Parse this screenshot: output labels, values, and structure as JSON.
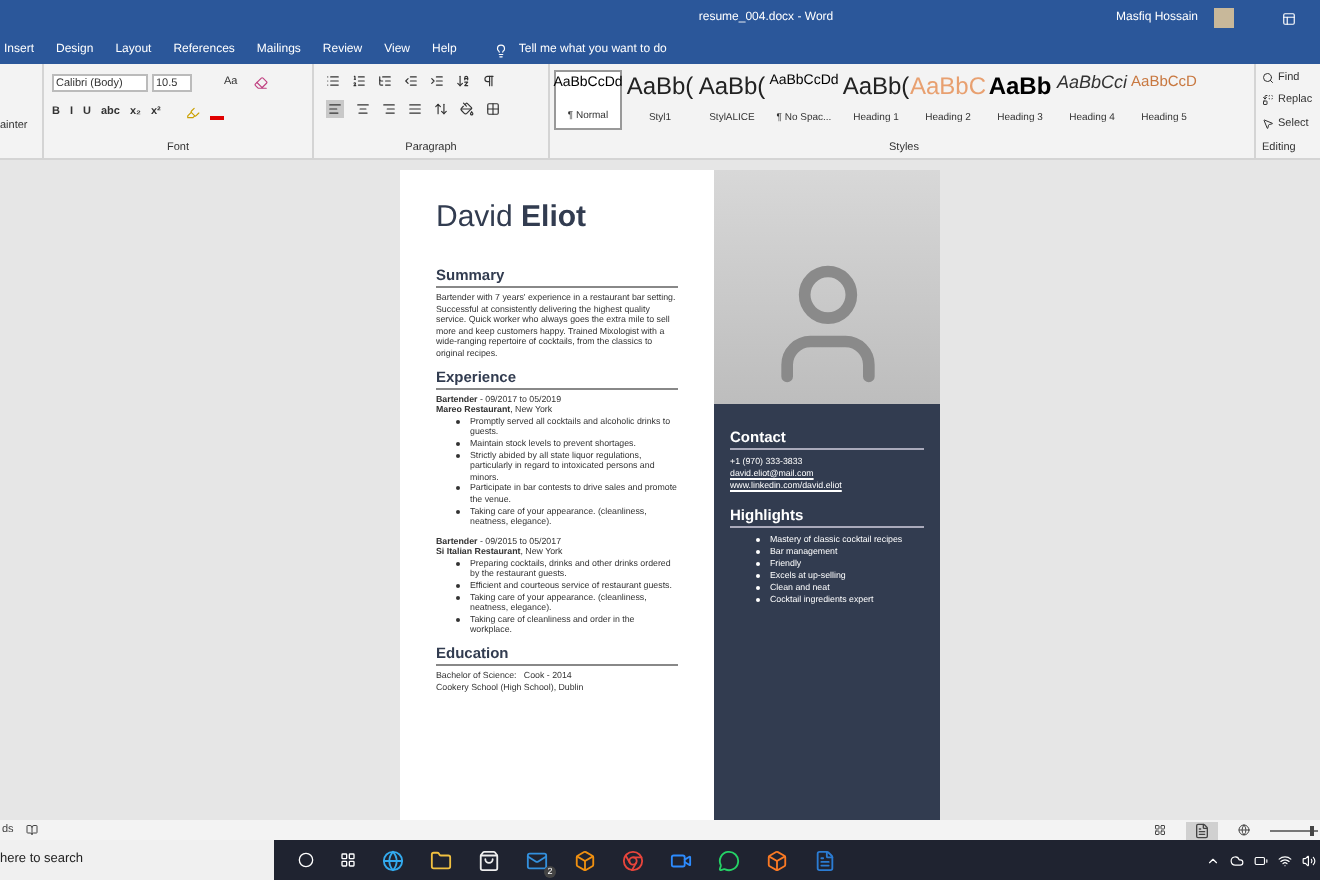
{
  "window": {
    "title": "resume_004.docx  -  Word",
    "user": "Masfiq Hossain"
  },
  "menu_tabs": [
    {
      "label": "Insert",
      "selected": false
    },
    {
      "label": "Design",
      "selected": false
    },
    {
      "label": "Layout",
      "selected": false
    },
    {
      "label": "References",
      "selected": false
    },
    {
      "label": "Mailings",
      "selected": false
    },
    {
      "label": "Review",
      "selected": false
    },
    {
      "label": "View",
      "selected": false
    },
    {
      "label": "Help",
      "selected": false
    }
  ],
  "tell_me": "Tell me what you want to do",
  "ribbon": {
    "clipboard_label": "ainter",
    "font_name": "Calibri (Body)",
    "font_size": "10.5",
    "case_button": "Aa",
    "format_buttons": [
      "B",
      "I",
      "U",
      "abc",
      "x₂",
      "x²"
    ],
    "font_group": "Font",
    "paragraph_group": "Paragraph",
    "styles_group": "Styles",
    "editing_group": "Editing",
    "styles": [
      {
        "sample": "AaBbCcDd",
        "name": "¶ Normal",
        "selected": true,
        "kind": "small"
      },
      {
        "sample": "AaBb(",
        "name": "Styl1",
        "selected": false,
        "kind": "large"
      },
      {
        "sample": "AaBb(",
        "name": "StylALICE",
        "selected": false,
        "kind": "large"
      },
      {
        "sample": "AaBbCcDd",
        "name": "¶ No Spac...",
        "selected": false,
        "kind": "small"
      },
      {
        "sample": "AaBb(",
        "name": "Heading 1",
        "selected": false,
        "kind": "large"
      },
      {
        "sample": "AaBbC",
        "name": "Heading 2",
        "selected": false,
        "kind": "accent"
      },
      {
        "sample": "AaBb",
        "name": "Heading 3",
        "selected": false,
        "kind": "bold"
      },
      {
        "sample": "AaBbCci",
        "name": "Heading 4",
        "selected": false,
        "kind": "italic"
      },
      {
        "sample": "AaBbCcD",
        "name": "Heading 5",
        "selected": false,
        "kind": "accentsmall"
      }
    ],
    "editing": [
      "Find",
      "Replac",
      "Select"
    ]
  },
  "resume": {
    "first_name": "David",
    "last_name": "Eliot",
    "summary_heading": "Summary",
    "summary": "Bartender with 7 years' experience in a restaurant bar setting. Successful at consistently delivering the highest quality service. Quick worker who always goes the extra mile to sell more and keep customers happy. Trained Mixologist with a wide-ranging repertoire of cocktails, from the classics to original recipes.",
    "experience_heading": "Experience",
    "jobs": [
      {
        "title": "Bartender",
        "dates": "- 09/2017 to 05/2019",
        "employer": "Mareo Restaurant",
        "place": ", New York",
        "bullets": [
          "Promptly served all cocktails and alcoholic drinks to guests.",
          "Maintain stock levels to prevent shortages.",
          "Strictly abided by all state liquor regulations, particularly in regard to intoxicated persons and minors.",
          "Participate in bar contests to drive sales and promote the venue.",
          "Taking care of your appearance. (cleanliness, neatness, elegance)."
        ]
      },
      {
        "title": "Bartender",
        "dates": "- 09/2015 to 05/2017",
        "employer": "Si Italian Restaurant",
        "place": ", New York",
        "bullets": [
          "Preparing cocktails, drinks and other drinks ordered by the restaurant guests.",
          "Efficient and courteous service of restaurant guests.",
          "Taking care of your appearance. (cleanliness, neatness, elegance).",
          "Taking care of cleanliness and order in the workplace."
        ]
      }
    ],
    "education_heading": "Education",
    "education": [
      "Bachelor of Science:   Cook - 2014",
      "Cookery School (High School), Dublin"
    ],
    "contact_heading": "Contact",
    "contact": [
      {
        "text": "+1 (970) 333-3833",
        "kind": "plain"
      },
      {
        "text": "david.eliot@mail.com",
        "kind": "link"
      },
      {
        "text": "www.linkedin.com/david.eliot",
        "kind": "link"
      }
    ],
    "highlights_heading": "Highlights",
    "highlights": [
      "Mastery of classic cocktail recipes",
      "Bar management",
      "Friendly",
      "Excels at up-selling",
      "Clean and neat",
      "Cocktail ingredients expert"
    ]
  },
  "status_bar": {
    "left": "ds",
    "zoom": {
      "level": 0.9
    }
  },
  "taskbar": {
    "search": "here to search",
    "mail_badge": "2"
  }
}
